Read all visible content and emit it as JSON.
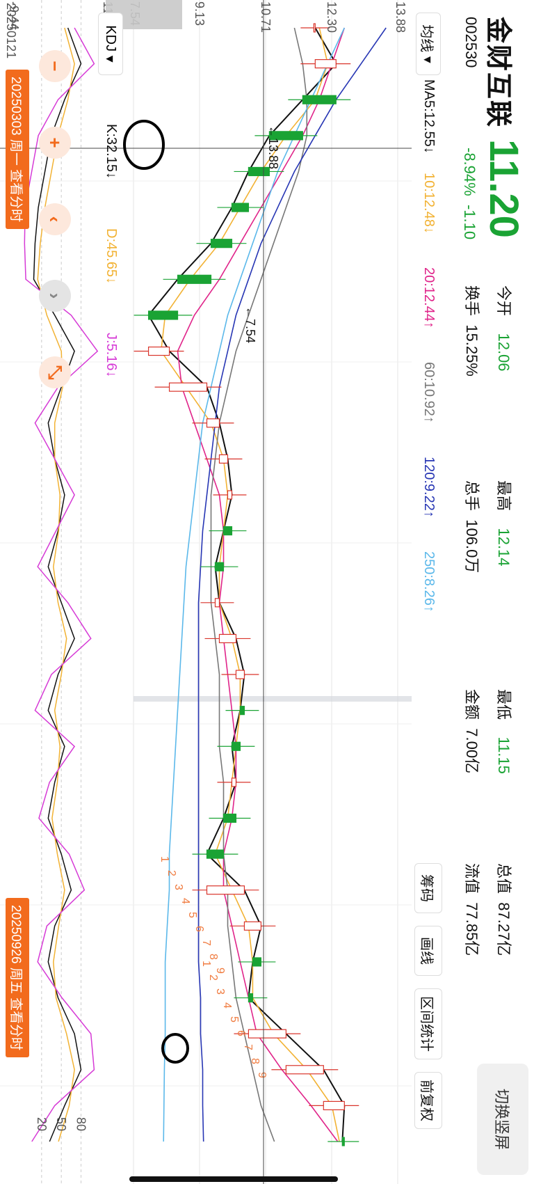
{
  "header": {
    "name": "金财互联",
    "code": "002530",
    "price": "11.20",
    "change_pct": "-8.94%",
    "change_abs": "-1.10",
    "stats": [
      {
        "label": "今开",
        "value": "12.06"
      },
      {
        "label": "最高",
        "value": "12.14"
      },
      {
        "label": "最低",
        "value": "11.15"
      },
      {
        "label": "总值",
        "value": "87.27亿"
      },
      {
        "label": "换手",
        "value": "15.25%"
      },
      {
        "label": "总手",
        "value": "106.0万"
      },
      {
        "label": "金额",
        "value": "7.00亿"
      },
      {
        "label": "流值",
        "value": "77.85亿"
      }
    ],
    "switch_label": "切换竖屏"
  },
  "toolbar": {
    "ma_select": "均线",
    "ma_values": [
      {
        "label": "MA5:12.55↓",
        "color": "#111111"
      },
      {
        "label": "10:12.48↓",
        "color": "#f2b233"
      },
      {
        "label": "20:12.44↑",
        "color": "#e0248a"
      },
      {
        "label": "60:10.92↑",
        "color": "#777777"
      },
      {
        "label": "120:9.22↑",
        "color": "#2736b4"
      },
      {
        "label": "250:8.26↑",
        "color": "#5bb8ea"
      }
    ],
    "buttons": [
      "筹码",
      "画线",
      "区间统计",
      "前复权"
    ]
  },
  "kdj": {
    "select": "KDJ",
    "k_label": "K:32.15↓",
    "d_label": "D:45.65↓",
    "j_label": "J:5.16↓",
    "axis_top": "112.23",
    "axis_bottom": "-9.44",
    "ref_lines": [
      "80",
      "50",
      "20"
    ]
  },
  "price_axis": {
    "top": "13.88",
    "mid1": "12.30",
    "mid2": "10.71",
    "mid3": "9.13",
    "bottom": "7.54",
    "crosshair": "13.88",
    "min_marker": "7.54"
  },
  "dates": {
    "start": "20250121",
    "tag_left": "20250303 周一 查看分时",
    "tag_right": "20250926 周五 查看分时"
  },
  "markers": [
    "1",
    "2",
    "3",
    "4",
    "5",
    "6",
    "7",
    "8",
    "9",
    "1",
    "2",
    "3",
    "4",
    "5",
    "6",
    "7",
    "8",
    "9"
  ],
  "colors": {
    "up": "#d9342b",
    "down": "#1aa334",
    "accent": "#f26b1d"
  },
  "chart_data": {
    "type": "line",
    "title": "金财互联 002530 日K",
    "x_range": [
      "20250121",
      "20250926"
    ],
    "ylim": [
      7.54,
      13.88
    ],
    "series": [
      {
        "name": "MA5",
        "values": [
          11.9,
          12.4,
          11.6,
          10.8,
          10.3,
          9.9,
          9.4,
          8.6,
          7.9,
          8.4,
          9.3,
          9.6,
          9.8,
          9.9,
          9.7,
          9.5,
          9.6,
          10.0,
          10.2,
          10.1,
          9.9,
          10.0,
          9.7,
          9.3,
          10.2,
          10.6,
          10.4,
          10.3,
          11.2,
          12.1,
          12.6,
          12.55
        ]
      },
      {
        "name": "MA10",
        "values": [
          12.0,
          12.2,
          11.9,
          11.2,
          10.6,
          10.1,
          9.6,
          8.9,
          8.3,
          8.2,
          8.8,
          9.4,
          9.7,
          9.8,
          9.7,
          9.6,
          9.6,
          9.9,
          10.1,
          10.1,
          10.0,
          9.9,
          9.8,
          9.5,
          9.9,
          10.3,
          10.4,
          10.4,
          10.9,
          11.7,
          12.3,
          12.48
        ]
      },
      {
        "name": "MA20",
        "values": [
          12.6,
          12.3,
          12.0,
          11.6,
          11.1,
          10.6,
          10.1,
          9.6,
          9.0,
          8.6,
          8.7,
          9.0,
          9.3,
          9.6,
          9.7,
          9.7,
          9.6,
          9.7,
          9.8,
          9.9,
          10.0,
          10.0,
          9.9,
          9.7,
          9.7,
          9.9,
          10.1,
          10.3,
          10.5,
          11.1,
          11.8,
          12.44
        ]
      },
      {
        "name": "MA60",
        "values": [
          11.4,
          11.6,
          11.7,
          11.7,
          11.5,
          11.2,
          10.9,
          10.6,
          10.3,
          10.0,
          9.8,
          9.6,
          9.5,
          9.4,
          9.4,
          9.4,
          9.4,
          9.5,
          9.6,
          9.6,
          9.6,
          9.7,
          9.7,
          9.7,
          9.8,
          9.8,
          9.9,
          10.0,
          10.2,
          10.4,
          10.6,
          10.92
        ]
      },
      {
        "name": "MA120",
        "values": [
          13.6,
          13.0,
          12.4,
          11.9,
          11.4,
          11.0,
          10.6,
          10.3,
          10.0,
          9.8,
          9.6,
          9.5,
          9.4,
          9.3,
          9.2,
          9.15,
          9.1,
          9.1,
          9.1,
          9.1,
          9.1,
          9.1,
          9.1,
          9.1,
          9.1,
          9.1,
          9.1,
          9.15,
          9.15,
          9.2,
          9.2,
          9.22
        ]
      },
      {
        "name": "MA250",
        "values": [
          12.6,
          12.2,
          11.8,
          11.4,
          11.0,
          10.7,
          10.4,
          10.1,
          9.8,
          9.6,
          9.4,
          9.2,
          9.1,
          9.0,
          8.9,
          8.8,
          8.75,
          8.7,
          8.65,
          8.6,
          8.55,
          8.5,
          8.45,
          8.4,
          8.4,
          8.35,
          8.3,
          8.3,
          8.3,
          8.28,
          8.27,
          8.26
        ]
      }
    ],
    "kdj": {
      "ylim": [
        -9.44,
        112.23
      ],
      "K": [
        60,
        80,
        55,
        35,
        25,
        15,
        10,
        8,
        40,
        70,
        50,
        30,
        40,
        55,
        45,
        30,
        50,
        70,
        45,
        30,
        55,
        40,
        30,
        50,
        65,
        40,
        30,
        45,
        70,
        80,
        55,
        32.15
      ],
      "D": [
        55,
        70,
        60,
        45,
        35,
        25,
        18,
        14,
        28,
        50,
        52,
        40,
        40,
        48,
        46,
        38,
        45,
        58,
        50,
        40,
        48,
        44,
        36,
        44,
        55,
        46,
        38,
        42,
        58,
        70,
        62,
        45.65
      ],
      "J": [
        70,
        100,
        45,
        15,
        5,
        -5,
        -6,
        -4,
        65,
        105,
        45,
        10,
        40,
        70,
        42,
        14,
        60,
        95,
        35,
        10,
        70,
        32,
        16,
        62,
        85,
        28,
        14,
        51,
        95,
        100,
        40,
        5.16
      ]
    }
  }
}
